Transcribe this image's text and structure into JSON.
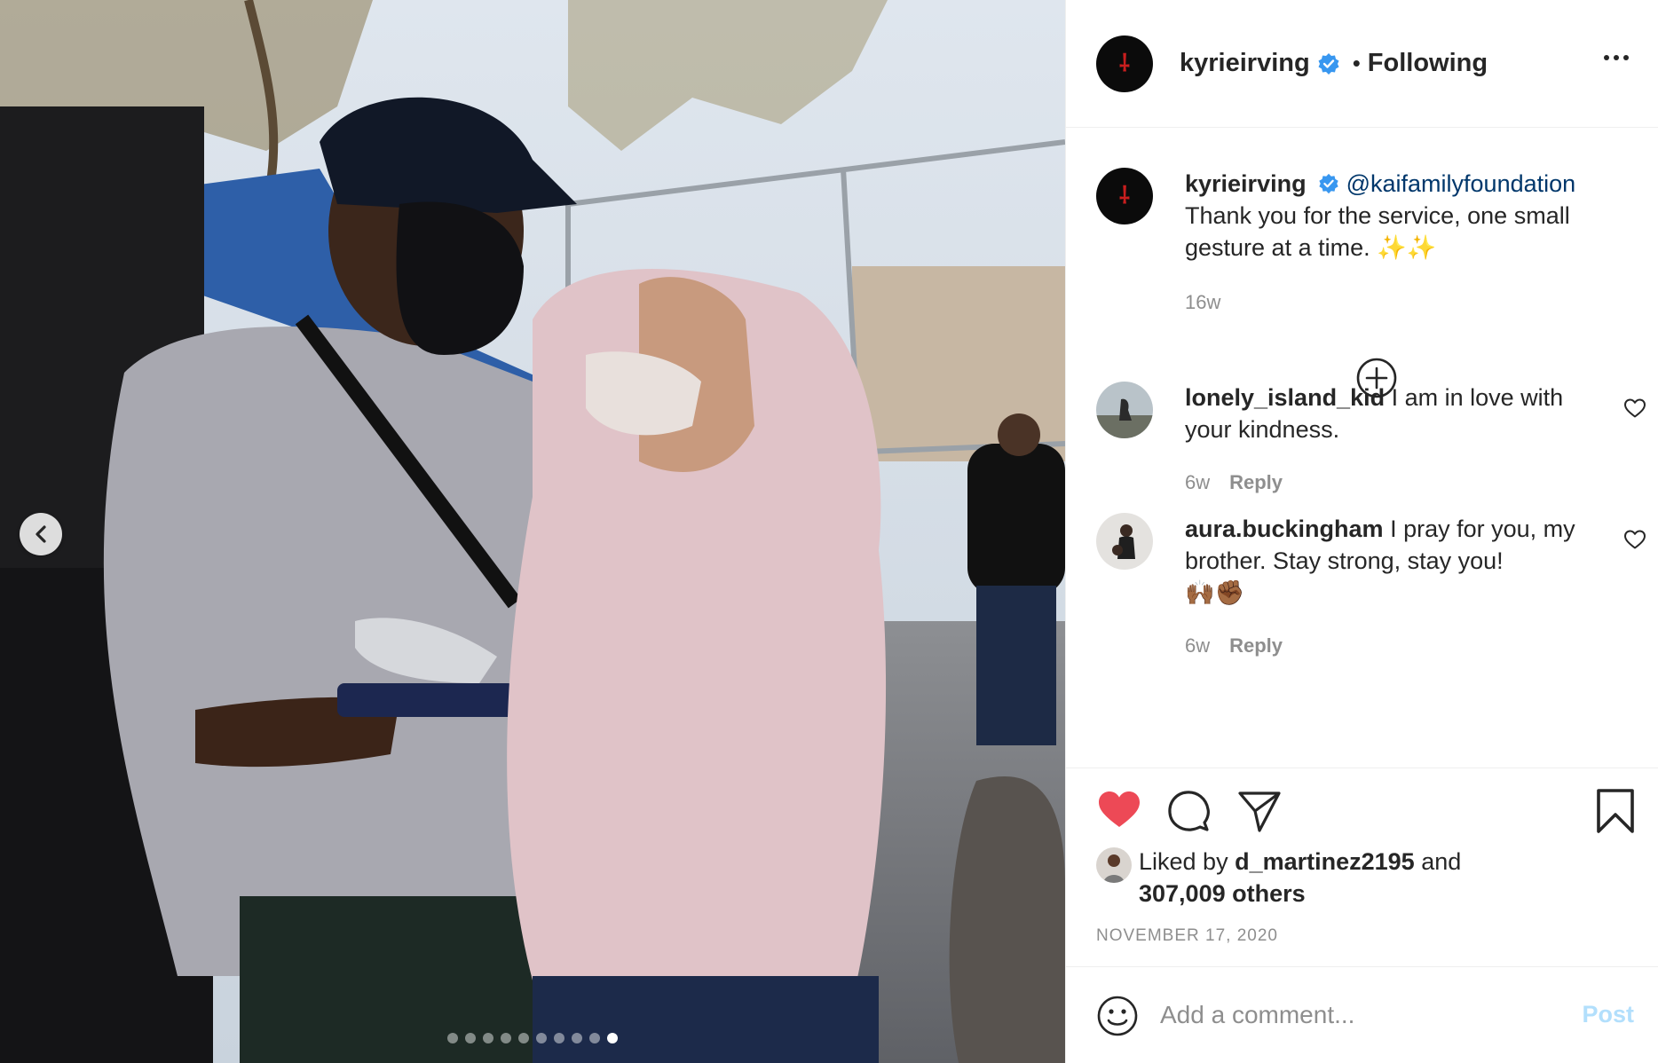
{
  "post": {
    "author": "kyrieirving",
    "follow_status": "Following",
    "separator": "•",
    "avatar_icon": "kai-logo-icon"
  },
  "caption": {
    "username": "kyrieirving",
    "mention": "@kaifamilyfoundation",
    "text": "Thank you for the service, one small gesture at a time.",
    "emoji": "✨✨",
    "age": "16w"
  },
  "comments": [
    {
      "username": "lonely_island_kid",
      "text": "I am in love with your kindness.",
      "age": "6w",
      "reply_label": "Reply"
    },
    {
      "username": "aura.buckingham",
      "text": "I pray for you, my brother. Stay strong, stay you!",
      "emoji": "🙌🏾✊🏾",
      "age": "6w",
      "reply_label": "Reply"
    }
  ],
  "likes": {
    "prefix": "Liked by",
    "user": "d_martinez2195",
    "conjunction": "and",
    "others": "307,009 others"
  },
  "date": "NOVEMBER 17, 2020",
  "comment_box": {
    "placeholder": "Add a comment...",
    "post_label": "Post"
  },
  "carousel": {
    "total": 10,
    "active_index": 9
  },
  "colors": {
    "like_red": "#ed4956",
    "verified_blue": "#3897f0",
    "link_navy": "#00376b",
    "post_disabled": "#b2dffc",
    "muted_gray": "#8e8e8e"
  }
}
